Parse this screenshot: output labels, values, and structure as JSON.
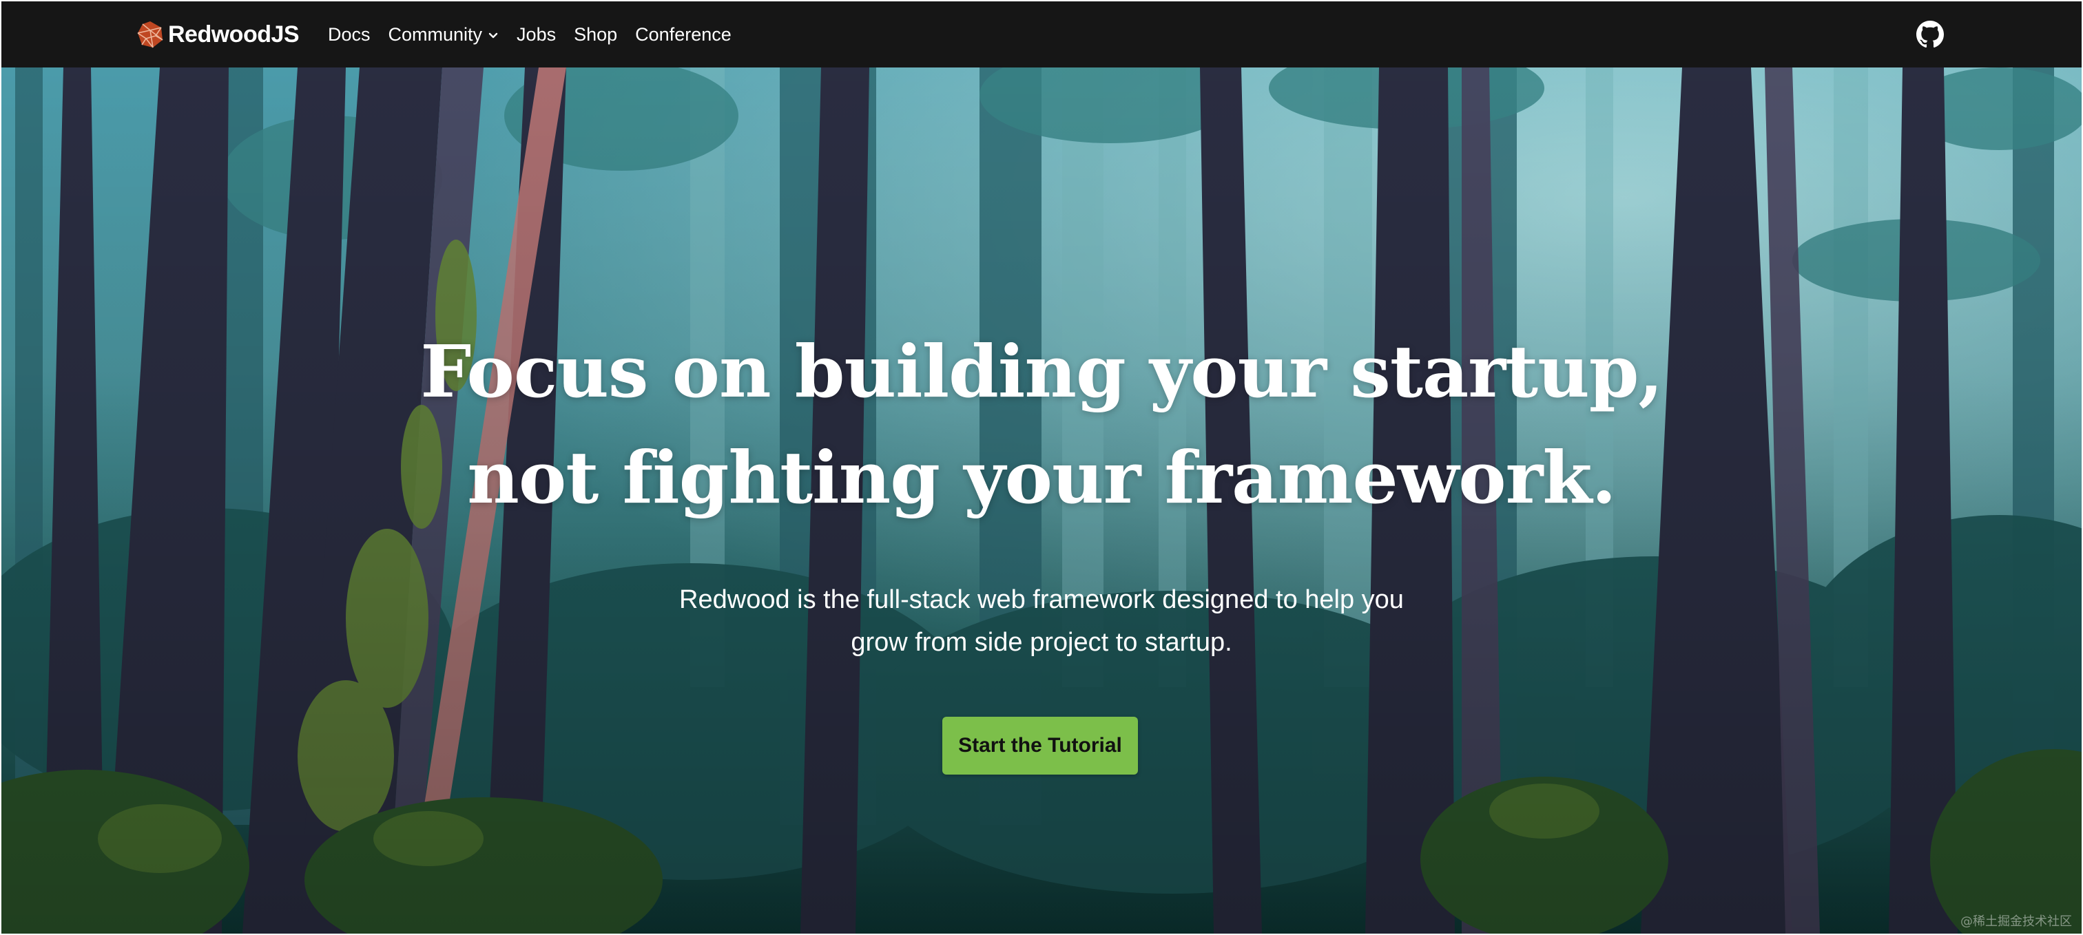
{
  "nav": {
    "brand": "RedwoodJS",
    "links": [
      {
        "label": "Docs"
      },
      {
        "label": "Community",
        "has_dropdown": true
      },
      {
        "label": "Jobs"
      },
      {
        "label": "Shop"
      },
      {
        "label": "Conference"
      }
    ],
    "github_icon": "github-icon"
  },
  "hero": {
    "headline_line1": "Focus on building your startup,",
    "headline_line2": "not fighting your framework.",
    "subtitle_line1": "Redwood is the full-stack web framework designed to help you",
    "subtitle_line2": "grow from side project to startup.",
    "cta_label": "Start the Tutorial"
  },
  "watermark": "@稀土掘金技术社区",
  "colors": {
    "nav_bg": "#161616",
    "brand_red": "#bf4722",
    "cta_green": "#7cbf4a",
    "forest_teal": "#5fb3bf",
    "forest_dark": "#0f3d3f"
  }
}
